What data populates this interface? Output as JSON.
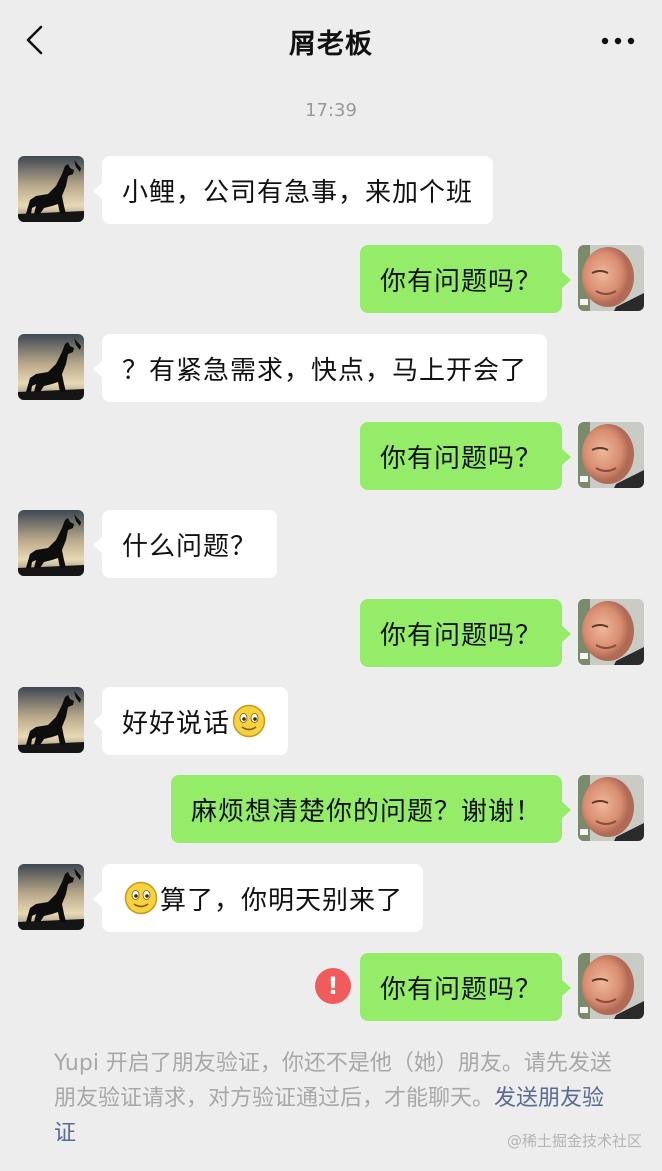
{
  "header": {
    "title": "屑老板",
    "back_icon": "chevron-left-icon",
    "more_icon": "ellipsis-icon"
  },
  "timestamp": "17:39",
  "messages": [
    {
      "from": "boss",
      "text": "小鲤，公司有急事，来加个班"
    },
    {
      "from": "me",
      "text": "你有问题吗？"
    },
    {
      "from": "boss",
      "text": "？有紧急需求，快点，马上开会了"
    },
    {
      "from": "me",
      "text": "你有问题吗？"
    },
    {
      "from": "boss",
      "text": "什么问题？"
    },
    {
      "from": "me",
      "text": "你有问题吗？"
    },
    {
      "from": "boss",
      "text": "好好说话",
      "emoji_after": "smile-emoji"
    },
    {
      "from": "me",
      "text": "麻烦想清楚你的问题？谢谢！"
    },
    {
      "from": "boss",
      "text": "算了，你明天别来了",
      "emoji_before": "smile-emoji"
    },
    {
      "from": "me",
      "text": "你有问题吗？",
      "status": "send-failed",
      "status_mark": "!"
    }
  ],
  "notice": {
    "text": "Yupi 开启了朋友验证，你还不是他（她）朋友。请先发送朋友验证请求，对方验证通过后，才能聊天。",
    "link": "发送朋友验证"
  },
  "watermark": "@稀土掘金技术社区",
  "colors": {
    "background": "#ededed",
    "incoming_bubble": "#ffffff",
    "outgoing_bubble": "#95ec69",
    "error": "#f05b5b",
    "link": "#576b95"
  }
}
